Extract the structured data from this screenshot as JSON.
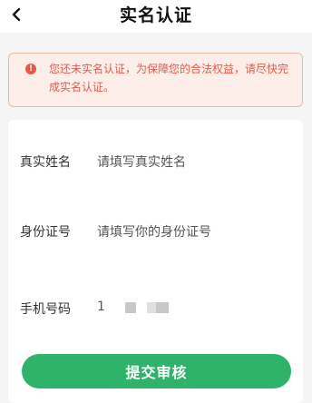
{
  "header": {
    "title": "实名认证",
    "back_icon": "back-arrow-icon"
  },
  "alert": {
    "icon": "alert-circle-icon",
    "icon_glyph": "!",
    "message": "您还未实名认证，为保障您的合法权益，请尽快完成实名认证。",
    "color": "#e25a4a"
  },
  "form": {
    "fields": [
      {
        "label": "真实姓名",
        "placeholder": "请填写真实姓名"
      },
      {
        "label": "身份证号",
        "placeholder": "请填写你的身份证号"
      },
      {
        "label": "手机号码",
        "value": "1"
      }
    ]
  },
  "submit": {
    "label": "提交审核",
    "color": "#2fb26a"
  }
}
